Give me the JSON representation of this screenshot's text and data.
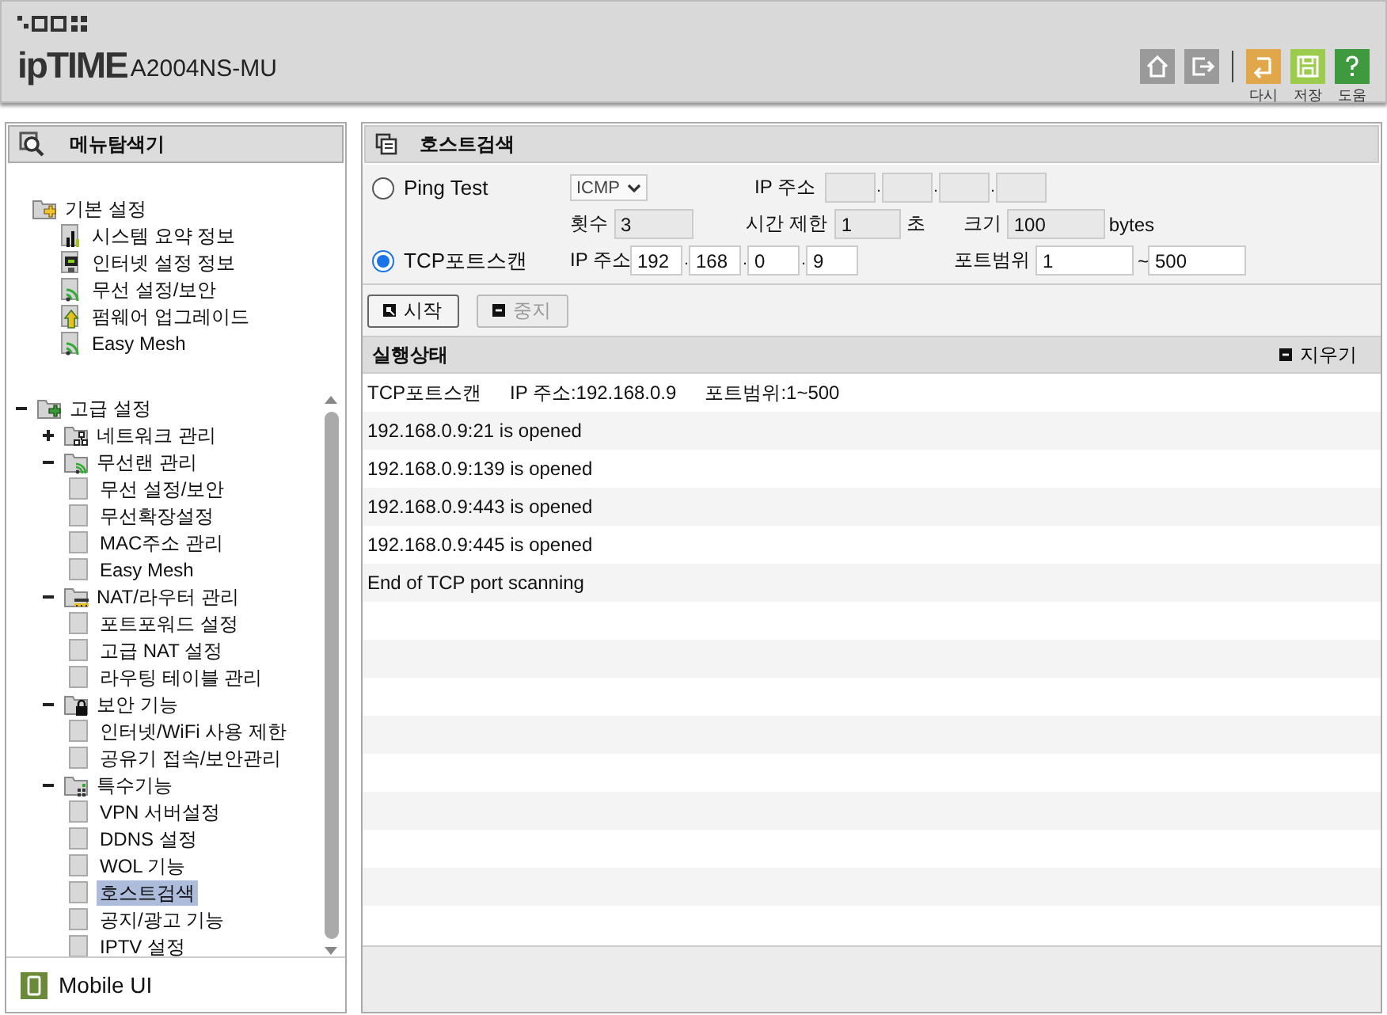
{
  "header": {
    "logo": "ipTIME",
    "model": "A2004NS-MU",
    "tools": [
      {
        "kind": "home"
      },
      {
        "kind": "exit"
      },
      {
        "kind": "undo",
        "label": "다시"
      },
      {
        "kind": "save",
        "label": "저장"
      },
      {
        "kind": "help",
        "label": "도움"
      }
    ]
  },
  "sidebar": {
    "title": "메뉴탐색기",
    "basic": [
      {
        "label": "기본 설정",
        "kind": "folder-basic",
        "children": [
          {
            "label": "시스템 요약 정보",
            "kind": "chart",
            "selected": false
          },
          {
            "label": "인터넷 설정 정보",
            "kind": "monitor",
            "selected": false
          },
          {
            "label": "무선 설정/보안",
            "kind": "wifi",
            "selected": false
          },
          {
            "label": "펌웨어 업그레이드",
            "kind": "upgrade",
            "selected": false
          },
          {
            "label": "Easy Mesh",
            "kind": "wifi",
            "selected": false
          }
        ]
      }
    ],
    "advanced": [
      {
        "label": "고급 설정",
        "kind": "folder-advanced",
        "expanded": true,
        "children": [
          {
            "label": "네트워크 관리",
            "kind": "folder-network",
            "expanded": false
          },
          {
            "label": "무선랜 관리",
            "kind": "folder-wifi",
            "expanded": true,
            "children": [
              {
                "label": "무선 설정/보안",
                "kind": "page",
                "selected": false
              },
              {
                "label": "무선확장설정",
                "kind": "page",
                "selected": false
              },
              {
                "label": "MAC주소 관리",
                "kind": "page",
                "selected": false
              },
              {
                "label": "Easy Mesh",
                "kind": "page",
                "selected": false
              }
            ]
          },
          {
            "label": "NAT/라우터 관리",
            "kind": "folder-nat",
            "expanded": true,
            "children": [
              {
                "label": "포트포워드 설정",
                "kind": "page",
                "selected": false
              },
              {
                "label": "고급 NAT 설정",
                "kind": "page",
                "selected": false
              },
              {
                "label": "라우팅 테이블 관리",
                "kind": "page",
                "selected": false
              }
            ]
          },
          {
            "label": "보안 기능",
            "kind": "folder-lock",
            "expanded": true,
            "children": [
              {
                "label": "인터넷/WiFi 사용 제한",
                "kind": "page",
                "selected": false
              },
              {
                "label": "공유기 접속/보안관리",
                "kind": "page",
                "selected": false
              }
            ]
          },
          {
            "label": "특수기능",
            "kind": "folder-special",
            "expanded": true,
            "children": [
              {
                "label": "VPN 서버설정",
                "kind": "page",
                "selected": false
              },
              {
                "label": "DDNS 설정",
                "kind": "page",
                "selected": false
              },
              {
                "label": "WOL 기능",
                "kind": "page",
                "selected": false
              },
              {
                "label": "호스트검색",
                "kind": "page",
                "selected": true
              },
              {
                "label": "공지/광고 기능",
                "kind": "page",
                "selected": false
              },
              {
                "label": "IPTV 설정",
                "kind": "page",
                "selected": false
              }
            ]
          }
        ]
      }
    ],
    "footer": "Mobile UI"
  },
  "main": {
    "title": "호스트검색",
    "ping": {
      "label": "Ping Test",
      "selected": false,
      "protocol": "ICMP",
      "ip_label": "IP 주소",
      "ip": [
        {
          "disabled": true
        },
        {
          "disabled": true
        },
        {
          "disabled": true
        },
        {
          "disabled": true
        }
      ],
      "separator": ".",
      "count_label": "횟수",
      "count": "3",
      "timeout_label": "시간 제한",
      "timeout": "1",
      "timeout_unit": "초",
      "size_label": "크기",
      "size": "100",
      "size_unit": "bytes"
    },
    "tcp": {
      "label": "TCP포트스캔",
      "selected": true,
      "ip_label": "IP 주소",
      "ip": [
        "192",
        "168",
        "0",
        "9"
      ],
      "separator": ".",
      "range_label": "포트범위",
      "range_from": "1",
      "range_sep": "~",
      "range_to": "500"
    },
    "buttons": [
      {
        "label": "시작",
        "kind": "start",
        "disabled": false
      },
      {
        "label": "중지",
        "kind": "stop",
        "disabled": true
      }
    ],
    "status": {
      "title": "실행상태",
      "clear": "지우기",
      "summary": [
        "TCP포트스캔",
        "IP 주소:192.168.0.9",
        "포트범위:1~500"
      ],
      "lines": [
        "192.168.0.9:21 is opened",
        "192.168.0.9:139 is opened",
        "192.168.0.9:443 is opened",
        "192.168.0.9:445 is opened",
        "End of TCP port scanning"
      ]
    }
  }
}
